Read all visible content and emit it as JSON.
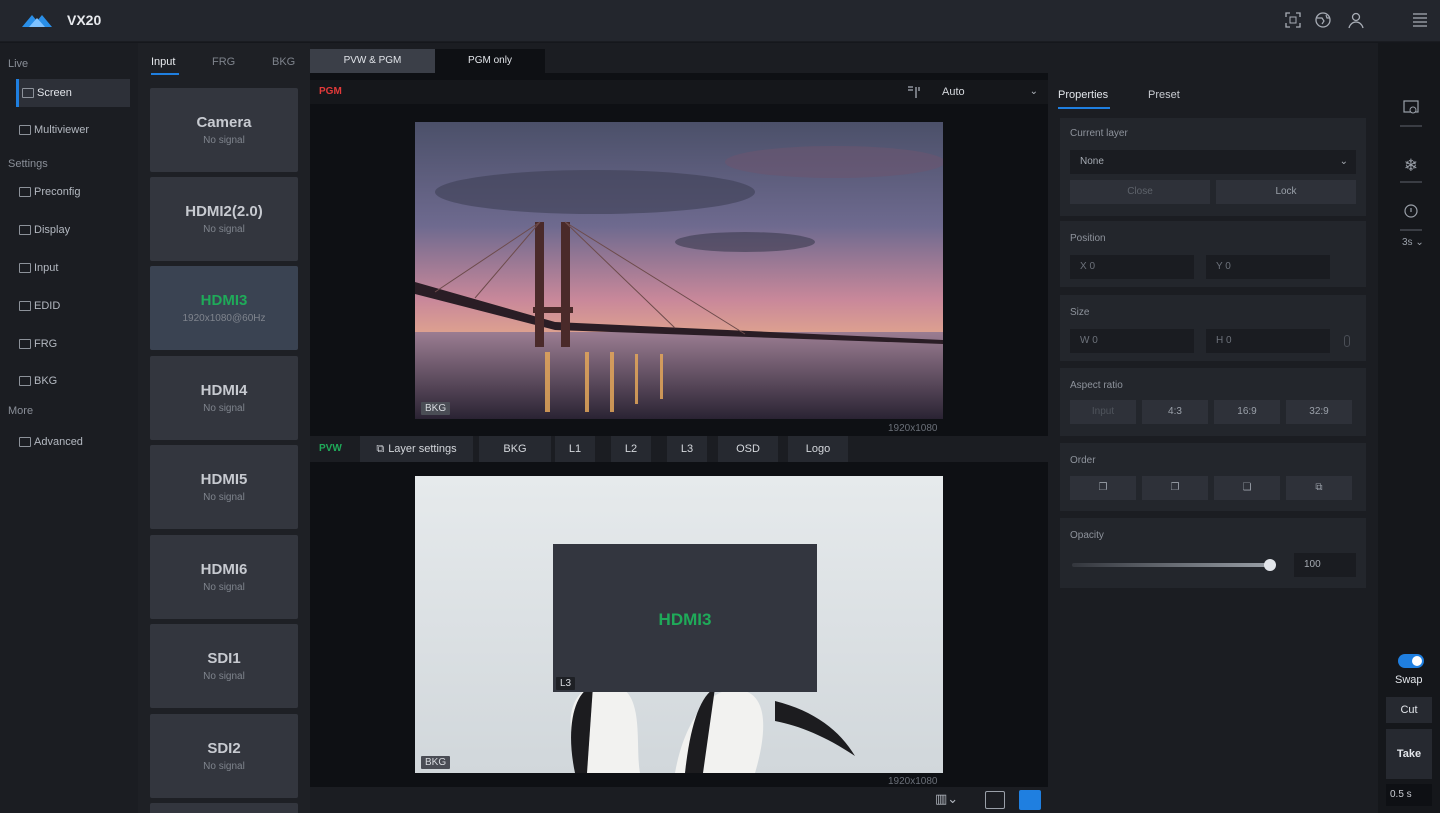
{
  "app": {
    "name": "VX20"
  },
  "topbar": {
    "icons": [
      "fullscreen-icon",
      "globe-icon",
      "user-icon",
      "menu-icon"
    ]
  },
  "nav": {
    "sections": {
      "live": "Live",
      "settings": "Settings",
      "more": "More"
    },
    "items": [
      {
        "label": "Screen",
        "icon": "screen-icon",
        "active": true
      },
      {
        "label": "Multiviewer",
        "icon": "multiviewer-icon"
      },
      {
        "label": "Preconfig",
        "icon": "preconfig-icon"
      },
      {
        "label": "Display",
        "icon": "display-icon"
      },
      {
        "label": "Input",
        "icon": "input-icon"
      },
      {
        "label": "EDID",
        "icon": "edid-icon"
      },
      {
        "label": "FRG",
        "icon": "frg-icon"
      },
      {
        "label": "BKG",
        "icon": "bkg-icon"
      },
      {
        "label": "Advanced",
        "icon": "advanced-icon"
      }
    ]
  },
  "inputs": {
    "tabs": [
      "Input",
      "FRG",
      "BKG"
    ],
    "cards": [
      {
        "name": "Camera",
        "signal": "No signal"
      },
      {
        "name": "HDMI2(2.0)",
        "signal": "No signal"
      },
      {
        "name": "HDMI3",
        "signal": "1920x1080@60Hz",
        "selected": true
      },
      {
        "name": "HDMI4",
        "signal": "No signal"
      },
      {
        "name": "HDMI5",
        "signal": "No signal"
      },
      {
        "name": "HDMI6",
        "signal": "No signal"
      },
      {
        "name": "SDI1",
        "signal": "No signal"
      },
      {
        "name": "SDI2",
        "signal": "No signal"
      }
    ]
  },
  "center": {
    "view_tabs": [
      "PVW & PGM",
      "PGM only"
    ],
    "pgm_label": "PGM",
    "auto_value": "Auto",
    "pgm_bkg_tag": "BKG",
    "pgm_resolution": "1920x1080",
    "pvw_label": "PVW",
    "pvw_buttons": [
      "Layer settings",
      "BKG",
      "L1",
      "L2",
      "L3",
      "OSD",
      "Logo"
    ],
    "layer_name": "HDMI3",
    "layer_tag": "L3",
    "pvw_bkg_tag": "BKG",
    "pvw_resolution": "1920x1080"
  },
  "props": {
    "tabs": [
      "Properties",
      "Preset"
    ],
    "current_layer_title": "Current layer",
    "current_layer_value": "None",
    "close_label": "Close",
    "lock_label": "Lock",
    "position_title": "Position",
    "pos_x": "X  0",
    "pos_y": "Y  0",
    "size_title": "Size",
    "size_w": "W  0",
    "size_h": "H  0",
    "aspect_title": "Aspect ratio",
    "aspect_options": [
      "Input",
      "4:3",
      "16:9",
      "32:9"
    ],
    "order_title": "Order",
    "opacity_title": "Opacity",
    "opacity_value": "100",
    "opacity_fraction": 1.0
  },
  "rightbar": {
    "timer": "3s",
    "swap_label": "Swap",
    "cut_label": "Cut",
    "take_label": "Take",
    "duration": "0.5 s",
    "swap_on": true
  },
  "colors": {
    "accent": "#1f7fe0",
    "pgm": "#e23a3a",
    "pvw": "#1faa59",
    "selected_input": "#1faa59"
  }
}
